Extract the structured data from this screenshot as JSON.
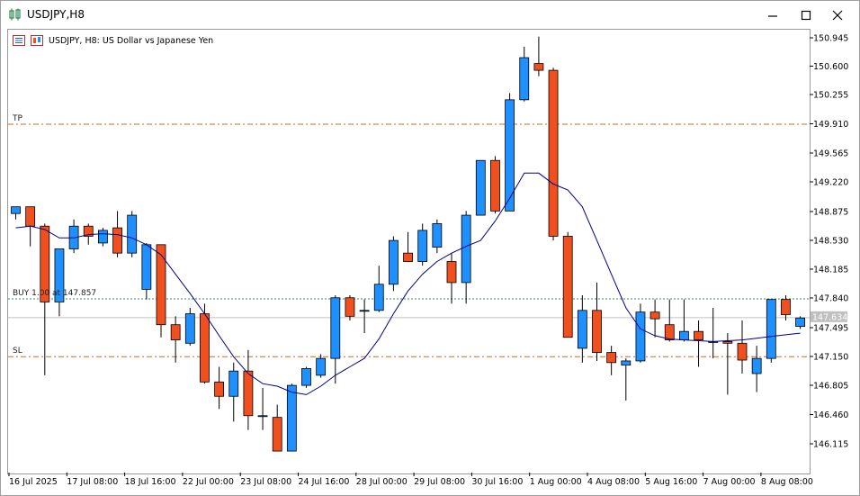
{
  "window": {
    "title": "USDJPY,H8"
  },
  "chart": {
    "header": "USDJPY, H8:  US Dollar vs Japanese Yen",
    "tp_label": "TP",
    "buy_label": "BUY 1.00 at 147.857",
    "sl_label": "SL",
    "current_price_label": "147.634",
    "colors": {
      "bull": "#1e90ff",
      "bear": "#f0501e",
      "ma": "#00008b",
      "tp_sl_line": "#d2691e",
      "buy_line": "#2e8b57",
      "bid_line": "#c0c0c0"
    }
  },
  "price_axis": {
    "ticks": [
      "150.945",
      "150.600",
      "150.255",
      "149.910",
      "149.565",
      "149.220",
      "148.875",
      "148.530",
      "148.185",
      "147.840",
      "147.495",
      "147.150",
      "146.805",
      "146.460",
      "146.115"
    ]
  },
  "time_axis": {
    "labels": [
      "16 Jul 2025",
      "17 Jul 08:00",
      "18 Jul 16:00",
      "22 Jul 00:00",
      "23 Jul 08:00",
      "24 Jul 16:00",
      "28 Jul 00:00",
      "29 Jul 08:00",
      "30 Jul 16:00",
      "1 Aug 00:00",
      "4 Aug 08:00",
      "5 Aug 16:00",
      "7 Aug 00:00",
      "8 Aug 08:00"
    ]
  },
  "chart_data": {
    "type": "candlestick",
    "symbol": "USDJPY",
    "timeframe": "H8",
    "ylim": [
      145.9,
      151.05
    ],
    "levels": {
      "tp": 149.93,
      "buy": 147.857,
      "sl": 147.17,
      "bid": 147.634
    },
    "candles": [
      {
        "o": 148.87,
        "h": 148.95,
        "l": 148.8,
        "c": 148.95
      },
      {
        "o": 148.95,
        "h": 148.95,
        "l": 148.48,
        "c": 148.72
      },
      {
        "o": 148.72,
        "h": 148.75,
        "l": 146.95,
        "c": 147.82
      },
      {
        "o": 147.82,
        "h": 148.4,
        "l": 147.65,
        "c": 148.45
      },
      {
        "o": 148.45,
        "h": 148.8,
        "l": 148.4,
        "c": 148.72
      },
      {
        "o": 148.72,
        "h": 148.75,
        "l": 148.5,
        "c": 148.6
      },
      {
        "o": 148.52,
        "h": 148.7,
        "l": 148.48,
        "c": 148.67
      },
      {
        "o": 148.7,
        "h": 148.9,
        "l": 148.35,
        "c": 148.4
      },
      {
        "o": 148.4,
        "h": 148.9,
        "l": 148.35,
        "c": 148.85
      },
      {
        "o": 147.97,
        "h": 148.52,
        "l": 147.85,
        "c": 148.5
      },
      {
        "o": 148.5,
        "h": 148.5,
        "l": 147.4,
        "c": 147.55
      },
      {
        "o": 147.55,
        "h": 147.65,
        "l": 147.1,
        "c": 147.37
      },
      {
        "o": 147.33,
        "h": 147.75,
        "l": 147.3,
        "c": 147.68
      },
      {
        "o": 147.68,
        "h": 147.8,
        "l": 146.85,
        "c": 146.87
      },
      {
        "o": 146.87,
        "h": 147.05,
        "l": 146.55,
        "c": 146.7
      },
      {
        "o": 146.7,
        "h": 147.1,
        "l": 146.4,
        "c": 147.0
      },
      {
        "o": 147.0,
        "h": 147.25,
        "l": 146.3,
        "c": 146.47
      },
      {
        "o": 146.47,
        "h": 146.8,
        "l": 146.3,
        "c": 146.47
      },
      {
        "o": 146.45,
        "h": 146.6,
        "l": 146.05,
        "c": 146.05
      },
      {
        "o": 146.05,
        "h": 146.85,
        "l": 146.05,
        "c": 146.83
      },
      {
        "o": 146.83,
        "h": 147.05,
        "l": 146.8,
        "c": 147.03
      },
      {
        "o": 146.95,
        "h": 147.2,
        "l": 146.92,
        "c": 147.15
      },
      {
        "o": 147.15,
        "h": 147.9,
        "l": 146.85,
        "c": 147.87
      },
      {
        "o": 147.87,
        "h": 147.9,
        "l": 147.6,
        "c": 147.65
      },
      {
        "o": 147.72,
        "h": 147.85,
        "l": 147.45,
        "c": 147.72
      },
      {
        "o": 147.72,
        "h": 148.25,
        "l": 147.7,
        "c": 148.03
      },
      {
        "o": 148.03,
        "h": 148.6,
        "l": 147.95,
        "c": 148.55
      },
      {
        "o": 148.4,
        "h": 148.65,
        "l": 148.35,
        "c": 148.3
      },
      {
        "o": 148.3,
        "h": 148.75,
        "l": 148.25,
        "c": 148.67
      },
      {
        "o": 148.47,
        "h": 148.8,
        "l": 148.4,
        "c": 148.75
      },
      {
        "o": 148.3,
        "h": 148.4,
        "l": 147.8,
        "c": 148.05
      },
      {
        "o": 148.05,
        "h": 148.9,
        "l": 147.8,
        "c": 148.85
      },
      {
        "o": 148.85,
        "h": 149.5,
        "l": 148.85,
        "c": 149.5
      },
      {
        "o": 149.5,
        "h": 149.55,
        "l": 148.87,
        "c": 148.9
      },
      {
        "o": 148.9,
        "h": 150.3,
        "l": 148.9,
        "c": 150.22
      },
      {
        "o": 150.22,
        "h": 150.85,
        "l": 150.2,
        "c": 150.72
      },
      {
        "o": 150.65,
        "h": 150.97,
        "l": 150.5,
        "c": 150.57
      },
      {
        "o": 150.57,
        "h": 150.6,
        "l": 148.55,
        "c": 148.6
      },
      {
        "o": 148.6,
        "h": 148.65,
        "l": 147.42,
        "c": 147.4
      },
      {
        "o": 147.27,
        "h": 147.9,
        "l": 147.1,
        "c": 147.72
      },
      {
        "o": 147.72,
        "h": 148.05,
        "l": 147.12,
        "c": 147.22
      },
      {
        "o": 147.22,
        "h": 147.3,
        "l": 146.95,
        "c": 147.1
      },
      {
        "o": 147.07,
        "h": 147.15,
        "l": 146.65,
        "c": 147.12
      },
      {
        "o": 147.12,
        "h": 147.8,
        "l": 147.1,
        "c": 147.7
      },
      {
        "o": 147.7,
        "h": 147.85,
        "l": 147.4,
        "c": 147.62
      },
      {
        "o": 147.55,
        "h": 147.85,
        "l": 147.35,
        "c": 147.37
      },
      {
        "o": 147.37,
        "h": 147.85,
        "l": 147.35,
        "c": 147.47
      },
      {
        "o": 147.47,
        "h": 147.6,
        "l": 147.05,
        "c": 147.37
      },
      {
        "o": 147.35,
        "h": 147.75,
        "l": 147.15,
        "c": 147.35
      },
      {
        "o": 147.35,
        "h": 147.45,
        "l": 146.72,
        "c": 147.33
      },
      {
        "o": 147.33,
        "h": 147.6,
        "l": 146.97,
        "c": 147.13
      },
      {
        "o": 146.97,
        "h": 147.3,
        "l": 146.75,
        "c": 147.15
      },
      {
        "o": 147.15,
        "h": 147.85,
        "l": 147.1,
        "c": 147.85
      },
      {
        "o": 147.85,
        "h": 147.9,
        "l": 147.6,
        "c": 147.67
      },
      {
        "o": 147.53,
        "h": 147.65,
        "l": 147.5,
        "c": 147.63
      }
    ],
    "ma": [
      148.7,
      148.72,
      148.68,
      148.58,
      148.58,
      148.62,
      148.63,
      148.62,
      148.58,
      148.5,
      148.38,
      148.15,
      147.92,
      147.68,
      147.42,
      147.17,
      146.97,
      146.85,
      146.82,
      146.75,
      146.72,
      146.82,
      146.95,
      147.05,
      147.15,
      147.38,
      147.68,
      147.95,
      148.15,
      148.3,
      148.4,
      148.48,
      148.55,
      148.78,
      149.05,
      149.35,
      149.35,
      149.22,
      149.15,
      148.95,
      148.55,
      148.15,
      147.75,
      147.5,
      147.42,
      147.38,
      147.37,
      147.36,
      147.35,
      147.36,
      147.37,
      147.39,
      147.41,
      147.43,
      147.45
    ]
  }
}
